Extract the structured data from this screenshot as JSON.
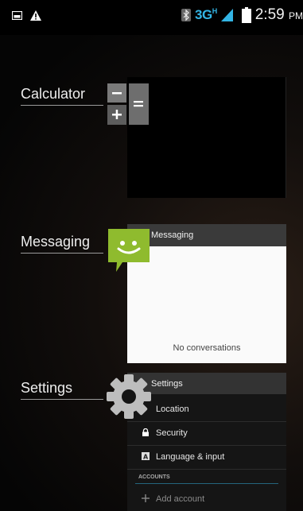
{
  "status_bar": {
    "left_icons": [
      "screenshot-icon",
      "warning-icon"
    ],
    "bluetooth_icon": "bluetooth-icon",
    "network": "3G",
    "network_sub": "H",
    "signal_icon": "signal-icon",
    "battery_icon": "battery-icon",
    "time": "2:59",
    "ampm": "PM"
  },
  "recents": [
    {
      "label": "Calculator",
      "icon": "calculator-icon"
    },
    {
      "label": "Messaging",
      "icon": "messaging-icon",
      "thumb_title": "Messaging",
      "empty_text": "No conversations"
    },
    {
      "label": "Settings",
      "icon": "settings-gear-icon",
      "thumb_title": "Settings",
      "rows": [
        "Location",
        "Security",
        "Language & input"
      ],
      "section_header": "ACCOUNTS",
      "add_account": "Add account"
    }
  ],
  "colors": {
    "accent": "#33b5e5",
    "msg_green": "#8fbb2e"
  }
}
